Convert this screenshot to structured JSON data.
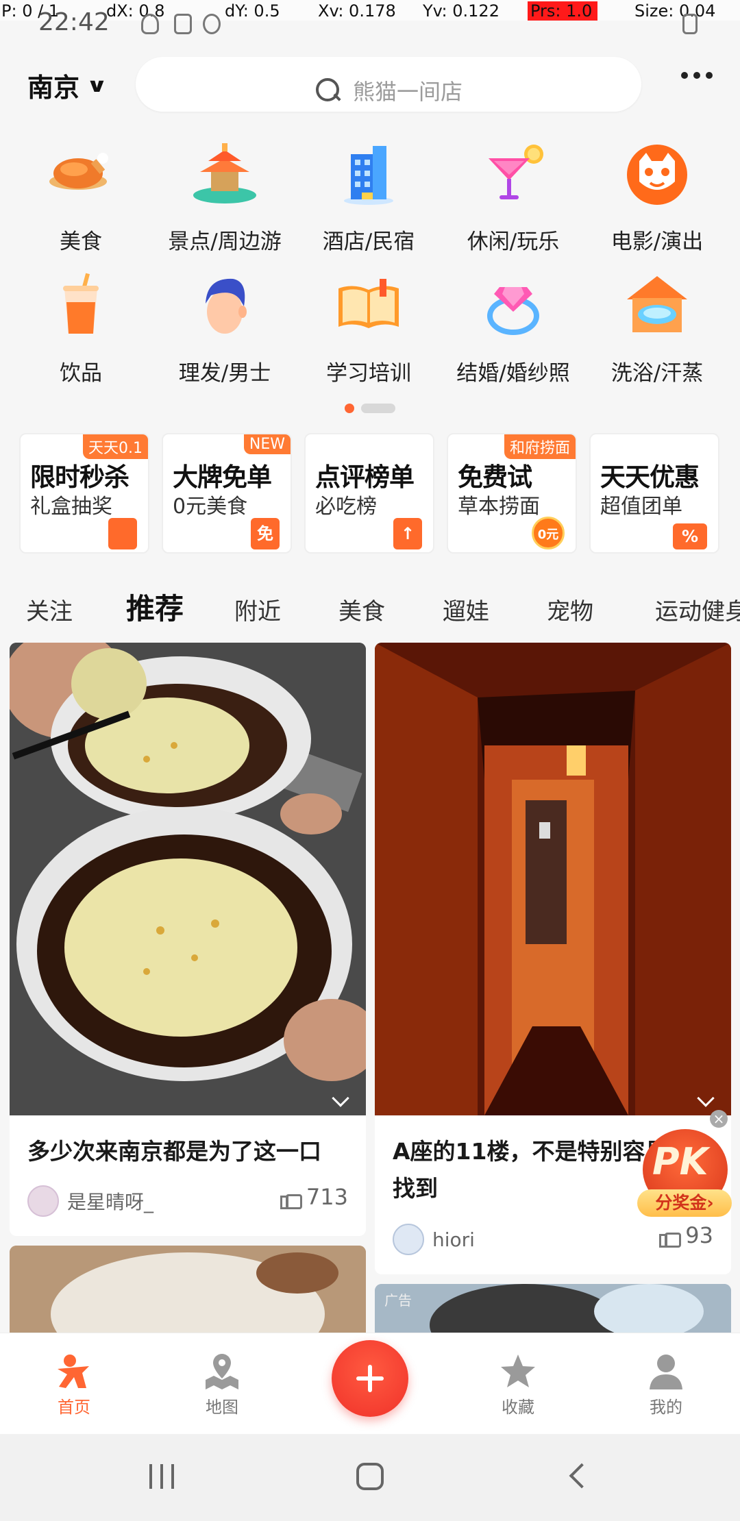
{
  "debug": {
    "p": "P: 0 / 1",
    "dx": "dX: 0.8",
    "dy": "dY: 0.5",
    "xv": "Xv: 0.178",
    "yv": "Yv: 0.122",
    "prs": "Prs: 1.0",
    "size": "Size: 0.04"
  },
  "status": {
    "time": "22:42"
  },
  "header": {
    "city": "南京",
    "search_placeholder": "熊猫一间店"
  },
  "categories": [
    {
      "label": "美食",
      "icon": "roast-chicken-icon"
    },
    {
      "label": "景点/周边游",
      "icon": "pavilion-icon"
    },
    {
      "label": "酒店/民宿",
      "icon": "hotel-building-icon"
    },
    {
      "label": "休闲/玩乐",
      "icon": "cocktail-icon"
    },
    {
      "label": "电影/演出",
      "icon": "cat-face-icon"
    },
    {
      "label": "饮品",
      "icon": "drink-cup-icon"
    },
    {
      "label": "理发/男士",
      "icon": "haircut-man-icon"
    },
    {
      "label": "学习培训",
      "icon": "open-book-icon"
    },
    {
      "label": "结婚/婚纱照",
      "icon": "diamond-ring-icon"
    },
    {
      "label": "洗浴/汗蒸",
      "icon": "bath-house-icon"
    }
  ],
  "promos": [
    {
      "title": "限时秒杀",
      "sub": "礼盒抽奖",
      "tag": "天天0.1",
      "badge": ""
    },
    {
      "title": "大牌免单",
      "sub": "0元美食",
      "tag": "NEW",
      "badge": "免"
    },
    {
      "title": "点评榜单",
      "sub": "必吃榜",
      "tag": "",
      "badge": "↑"
    },
    {
      "title": "免费试",
      "sub": "草本捞面",
      "tag": "和府捞面",
      "badge": "0元"
    },
    {
      "title": "天天优惠",
      "sub": "超值团单",
      "tag": "",
      "badge": "%"
    }
  ],
  "tabs": [
    "关注",
    "推荐",
    "附近",
    "美食",
    "遛娃",
    "宠物",
    "运动健身"
  ],
  "feed": {
    "left": {
      "title": "多少次来南京都是为了这一口",
      "author": "是星晴呀_",
      "likes": "713"
    },
    "right": {
      "title": "A座的11楼，不是特别容易找到",
      "author": "hiori",
      "likes": "93"
    },
    "ad_label": "广告"
  },
  "pk": {
    "text": "PK",
    "pill": "分奖金›",
    "close": "×"
  },
  "bottom_nav": [
    {
      "label": "首页",
      "active": true
    },
    {
      "label": "地图",
      "active": false
    },
    {
      "label": "收藏",
      "active": false
    },
    {
      "label": "我的",
      "active": false
    }
  ],
  "colors": {
    "accent": "#ff6633",
    "plus_button": "#f0322a",
    "tab_underline": "#ff6633"
  }
}
